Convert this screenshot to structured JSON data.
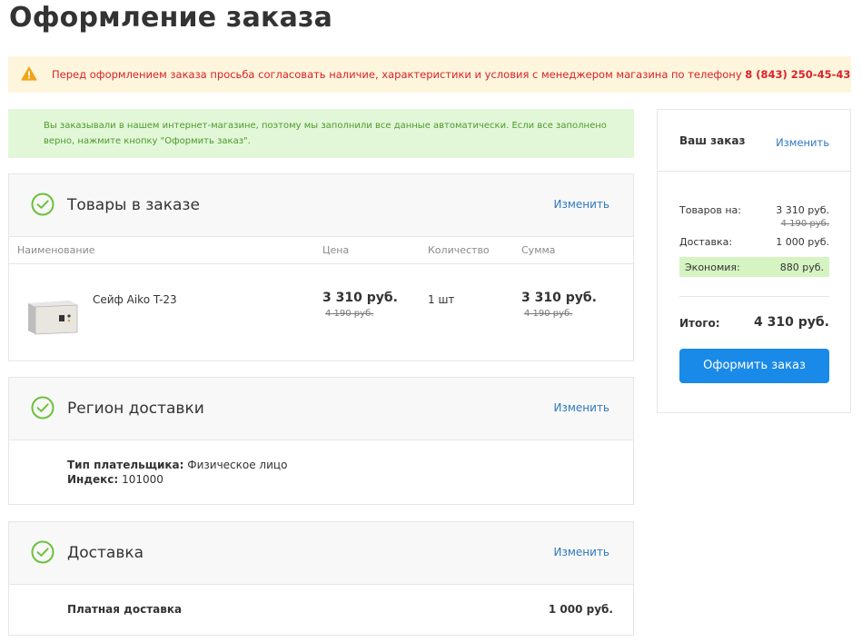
{
  "page": {
    "title": "Оформление заказа"
  },
  "warning": {
    "text": "Перед оформлением заказа просьба согласовать наличие, характеристики и условия с менеджером магазина по телефону",
    "phone": "8 (843) 250-45-43"
  },
  "info": {
    "text": "Вы заказывали в нашем интернет-магазине, поэтому мы заполнили все данные автоматически. Если все заполнено верно, нажмите кнопку \"Оформить заказ\"."
  },
  "goods_block": {
    "title": "Товары в заказе",
    "change_label": "Изменить",
    "columns": [
      "Наименование",
      "Цена",
      "Количество",
      "Сумма"
    ],
    "items": [
      {
        "name": "Сейф Aiko T-23",
        "price": "3 310 руб.",
        "old_price": "4 190 руб.",
        "quantity": "1 шт",
        "sum": "3 310 руб.",
        "old_sum": "4 190 руб."
      }
    ]
  },
  "region_block": {
    "title": "Регион доставки",
    "change_label": "Изменить",
    "payer_type_label": "Тип плательщика:",
    "payer_type_value": "Физическое лицо",
    "index_label": "Индекс:",
    "index_value": "101000"
  },
  "delivery_block": {
    "title": "Доставка",
    "change_label": "Изменить",
    "method": "Платная доставка",
    "price": "1 000 руб."
  },
  "summary": {
    "title": "Ваш заказ",
    "change_label": "Изменить",
    "goods_label": "Товаров на:",
    "goods_value": "3 310 руб.",
    "goods_old_value": "4 190 руб.",
    "delivery_label": "Доставка:",
    "delivery_value": "1 000 руб.",
    "economy_label": "Экономия:",
    "economy_value": "880 руб.",
    "total_label": "Итого:",
    "total_value": "4 310 руб.",
    "order_button": "Оформить заказ"
  },
  "colors": {
    "accent": "#1a8ae8",
    "link": "#2f78c0",
    "warning_text": "#d9222a",
    "warning_bg": "#fdf5dc",
    "success": "#4d9a2a",
    "success_bg": "#e2f7d8",
    "check": "#6cc13a"
  },
  "icons": {
    "warning": "warning-triangle-icon",
    "check": "check-circle-icon"
  }
}
